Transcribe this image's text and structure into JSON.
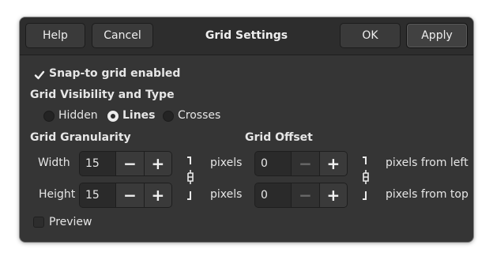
{
  "header": {
    "title": "Grid Settings",
    "help_label": "Help",
    "cancel_label": "Cancel",
    "ok_label": "OK",
    "apply_label": "Apply"
  },
  "snap": {
    "label": "Snap-to grid enabled",
    "checked": true
  },
  "visibility": {
    "heading": "Grid Visibility and Type",
    "options": [
      {
        "label": "Hidden",
        "selected": false
      },
      {
        "label": "Lines",
        "selected": true
      },
      {
        "label": "Crosses",
        "selected": false
      }
    ]
  },
  "granularity": {
    "heading": "Grid Granularity",
    "width_label": "Width",
    "width_value": "15",
    "height_label": "Height",
    "height_value": "15",
    "unit_width": "pixels",
    "unit_height": "pixels",
    "minus_symbol": "−",
    "plus_symbol": "+"
  },
  "offset": {
    "heading": "Grid Offset",
    "x_value": "0",
    "y_value": "0",
    "unit_left": "pixels from left",
    "unit_top": "pixels from top"
  },
  "preview": {
    "label": "Preview",
    "checked": false
  },
  "colors": {
    "background": "#353535",
    "header": "#2d2d2d",
    "text": "#e6e6e6"
  },
  "icons": [
    "check-icon",
    "chain-link-icon",
    "minus-icon",
    "plus-icon"
  ]
}
